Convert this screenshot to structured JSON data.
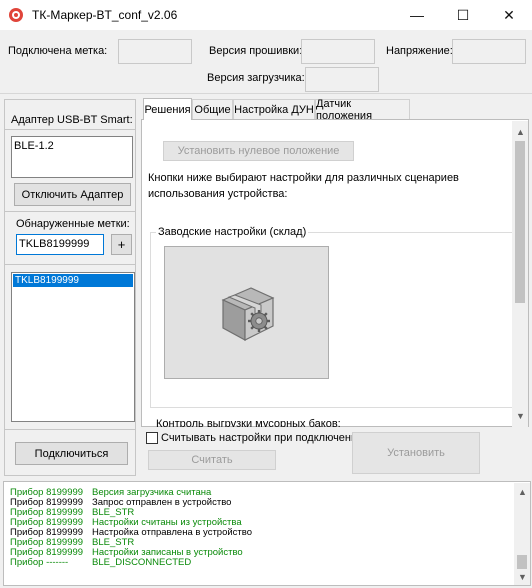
{
  "window": {
    "title": "ТК-Маркер-BT_conf_v2.06",
    "minimize": "—",
    "maximize": "☐",
    "close": "✕"
  },
  "header": {
    "connected_tag_label": "Подключена метка:",
    "firmware_label": "Версия прошивки:",
    "voltage_label": "Напряжение:",
    "bootloader_label": "Версия загрузчика:"
  },
  "left": {
    "adapter_title": "Адаптер USB-BT Smart:",
    "adapter_value": "BLE-1.2",
    "disconnect_button": "Отключить Адаптер",
    "found_tags_label": "Обнаруженные метки:",
    "tag_input_value": "TKLB8199999",
    "add_button": "+",
    "tags_list": [
      "TKLB8199999"
    ],
    "connect_button": "Подключиться"
  },
  "tabs": [
    {
      "label": "Решения",
      "active": true
    },
    {
      "label": "Общие",
      "active": false
    },
    {
      "label": "Настройка ДУН",
      "active": false
    },
    {
      "label": "Датчик положения",
      "active": false
    }
  ],
  "solutions": {
    "set_zero_button": "Установить нулевое положение",
    "description_line1": "Кнопки ниже выбирают настройки для различных сценариев",
    "description_line2": "использования устройства:",
    "factory_group": "Заводские настройки (склад)",
    "next_group_cut": "Контроль выгрузки мусорных баков:"
  },
  "bottom": {
    "read_on_connect_label": "Считывать настройки при подключении",
    "read_button": "Считать",
    "apply_button": "Установить"
  },
  "log": [
    {
      "src": "Прибор 8199999",
      "msg": "Версия загрузчика считана",
      "color": "green"
    },
    {
      "src": "Прибор 8199999",
      "msg": "Запрос отправлен в устройство",
      "color": "black"
    },
    {
      "src": "Прибор 8199999",
      "msg": "BLE_STR",
      "color": "green"
    },
    {
      "src": "Прибор 8199999",
      "msg": "Настройки считаны из устройства",
      "color": "green"
    },
    {
      "src": "Прибор 8199999",
      "msg": "Настройка отправлена в устройство",
      "color": "black"
    },
    {
      "src": "Прибор 8199999",
      "msg": "BLE_STR",
      "color": "green"
    },
    {
      "src": "Прибор 8199999",
      "msg": "Настройки записаны в устройство",
      "color": "green"
    },
    {
      "src": "Прибор -------",
      "msg": "BLE_DISCONNECTED",
      "color": "black"
    }
  ],
  "colors": {
    "selection": "#0078d7",
    "log_green": "#0a8a0a",
    "app_icon": "#e0453a"
  },
  "icons": {
    "app": "app-logo-icon",
    "factory": "box-gear-icon"
  }
}
